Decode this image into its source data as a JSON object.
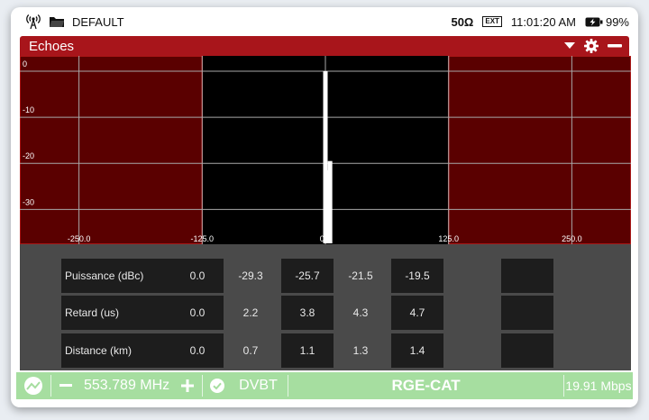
{
  "status_bar": {
    "profile": "DEFAULT",
    "impedance": "50Ω",
    "ext_badge": "EXT",
    "time": "11:01:20 AM",
    "battery": "99%"
  },
  "panel": {
    "title": "Echoes"
  },
  "chart_data": {
    "type": "bar",
    "x_ticks": [
      "-250.0",
      "-125.0",
      "0.0",
      "125.0",
      "250.0"
    ],
    "y_ticks": [
      "0",
      "-10",
      "-20",
      "-30"
    ],
    "x_range": [
      -310,
      310
    ],
    "y_range": [
      0,
      -36
    ],
    "shaded_regions": [
      [
        -310,
        -125
      ],
      [
        125,
        310
      ]
    ],
    "series": [
      {
        "x": [
          0.0,
          2.2,
          3.8,
          4.3,
          4.7
        ],
        "values": [
          0.0,
          -29.3,
          -25.7,
          -21.5,
          -19.5
        ]
      }
    ],
    "colors": {
      "background": "#000000",
      "shade": "#5a0000",
      "shade_border": "#c21d1d",
      "bar": "#ffffff",
      "grid": "#a8a8a8"
    }
  },
  "table": {
    "rows": [
      {
        "label": "Puissance (dBc)",
        "values": [
          "0.0",
          "-29.3",
          "-25.7",
          "-21.5",
          "-19.5"
        ]
      },
      {
        "label": "Retard (us)",
        "values": [
          "0.0",
          "2.2",
          "3.8",
          "4.3",
          "4.7"
        ]
      },
      {
        "label": "Distance (km)",
        "values": [
          "0.0",
          "0.7",
          "1.1",
          "1.3",
          "1.4"
        ]
      }
    ]
  },
  "bottom_bar": {
    "frequency": "553.789 MHz",
    "modulation": "DVBT",
    "service": "RGE-CAT",
    "bitrate": "19.91 Mbps"
  }
}
